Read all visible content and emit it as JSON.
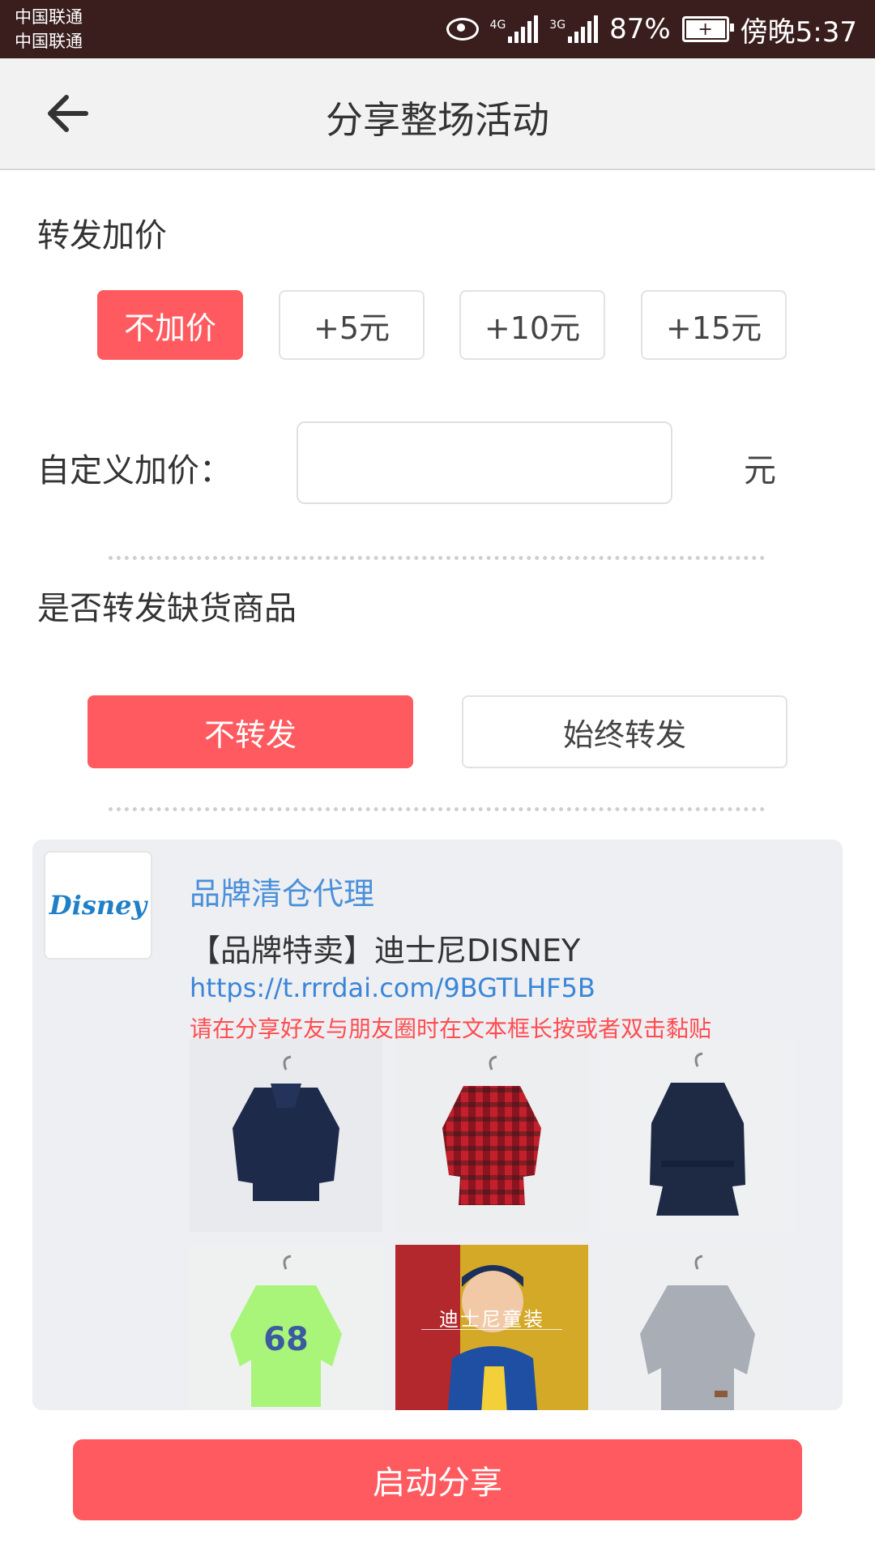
{
  "status_bar": {
    "carrier_1": "中国联通",
    "carrier_2": "中国联通",
    "net_1": "4G",
    "net_2": "3G",
    "battery_percent": "87%",
    "time": "傍晚5:37"
  },
  "header": {
    "title": "分享整场活动"
  },
  "markup": {
    "label": "转发加价",
    "options": [
      "不加价",
      "+5元",
      "+10元",
      "+15元"
    ],
    "selected_index": 0,
    "custom_label": "自定义加价：",
    "custom_value": "",
    "unit": "元"
  },
  "forward_out_of_stock": {
    "label": "是否转发缺货商品",
    "options": [
      "不转发",
      "始终转发"
    ],
    "selected_index": 0
  },
  "preview": {
    "logo_text": "Disney",
    "title": "品牌清仓代理",
    "name": "【品牌特卖】迪士尼DISNEY",
    "link": "https://t.rrrdai.com/9BGTLHF5B",
    "note": "请在分享好友与朋友圈时在文本框长按或者双击黏贴",
    "banner_text": "迪士尼童装",
    "thumbs": [
      "navy-hooded-coat",
      "red-plaid-coat",
      "navy-trench-coat",
      "green-sweatshirt-68",
      "disney-kids-banner",
      "grey-sweater"
    ]
  },
  "actions": {
    "share_button": "启动分享"
  },
  "colors": {
    "accent": "#ff5a5f",
    "link": "#3a86d6",
    "status_bar": "#3a1e1e"
  }
}
